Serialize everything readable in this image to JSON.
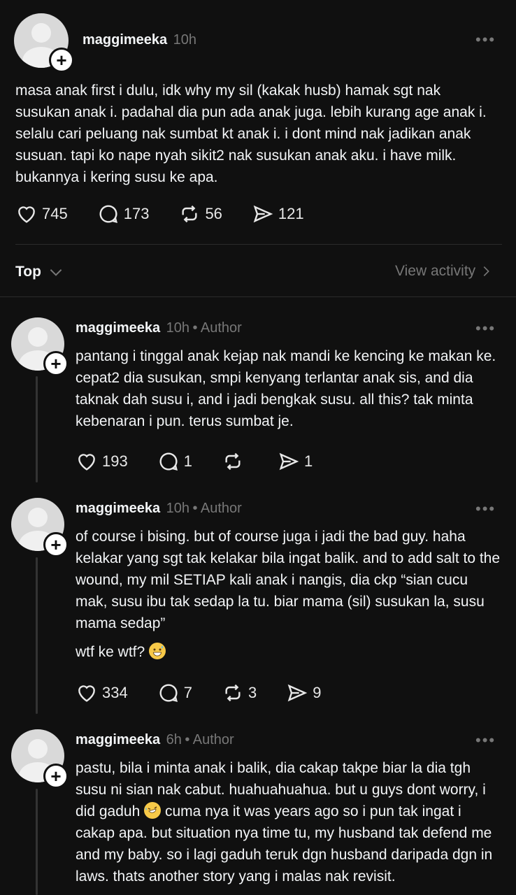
{
  "post": {
    "username": "maggimeeka",
    "time": "10h",
    "text": "masa anak first i dulu, idk why my sil (kakak husb) hamak sgt nak susukan anak i. padahal dia pun ada anak juga. lebih kurang age anak i. selalu cari peluang nak sumbat kt anak i. i dont mind nak jadikan anak susuan. tapi ko nape nyah sikit2 nak susukan anak aku. i have milk. bukannya i kering susu ke apa.",
    "likes": "745",
    "replies": "173",
    "reposts": "56",
    "shares": "121"
  },
  "sort": {
    "label": "Top",
    "view_activity": "View activity"
  },
  "replies": [
    {
      "username": "maggimeeka",
      "time": "10h",
      "tag": "• Author",
      "text": "pantang i tinggal anak kejap nak mandi ke kencing ke makan ke. cepat2 dia susukan, smpi kenyang terlantar anak sis, and dia taknak dah susu i, and i jadi bengkak susu. all this? tak minta kebenaran i pun. terus sumbat je.",
      "likes": "193",
      "replies": "1",
      "reposts": "",
      "shares": "1"
    },
    {
      "username": "maggimeeka",
      "time": "10h",
      "tag": "• Author",
      "text": "of course i bising. but of course juga i jadi the bad guy. haha kelakar yang sgt tak kelakar bila ingat balik. and to add salt to the wound, my mil SETIAP kali anak i nangis, dia ckp “sian cucu mak, susu ibu tak sedap la tu. biar mama (sil) susukan la, susu mama sedap”",
      "text2": "wtf ke wtf?",
      "likes": "334",
      "replies": "7",
      "reposts": "3",
      "shares": "9"
    },
    {
      "username": "maggimeeka",
      "time": "6h",
      "tag": "• Author",
      "text_a": "pastu, bila i minta anak i balik, dia cakap takpe biar la dia tgh susu ni sian nak cabut. huahuahuahua. but u guys dont worry, i did gaduh",
      "text_b": "cuma nya it was years ago so i pun tak ingat i cakap apa. but situation nya time tu, my husband tak defend me and my baby. so i lagi gaduh teruk dgn husband daripada dgn in laws. thats another story yang i malas nak revisit."
    }
  ],
  "icons": [
    "heart-icon",
    "comment-icon",
    "repost-icon",
    "share-icon",
    "more-icon",
    "follow-plus-icon",
    "chevron-down-icon",
    "chevron-right-icon"
  ]
}
